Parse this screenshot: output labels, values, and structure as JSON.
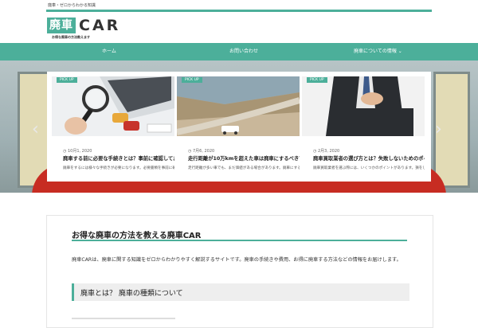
{
  "header": {
    "tagline": "廃車・ゼロからわかる知識",
    "logo_box": "廃車",
    "logo_car": "CAR",
    "logo_sub": "お得な廃車の方法教えます"
  },
  "nav": {
    "items": [
      {
        "label": "ホーム"
      },
      {
        "label": "お問い合わせ"
      },
      {
        "label": "廃車についての情報 ⌄"
      }
    ]
  },
  "slider": {
    "prev_icon": "‹",
    "next_icon": "›",
    "cards": [
      {
        "badge": "PICK UP",
        "date": "◷ 10月1, 2020",
        "title": "廃車する前に必要な手続きとは？事前に確認しておくべき書類",
        "desc": "廃車をするには様々な手続きが必要になります。必要書類を事前に確認し、スムーズに"
      },
      {
        "badge": "PICK UP",
        "date": "◷ 7月6, 2020",
        "title": "走行距離が10万kmを超えた車は廃車にするべき？その判断基準",
        "desc": "走行距離が多い車でも、まだ価値がある場合があります。廃車にするかどうかの判断"
      },
      {
        "badge": "PICK UP",
        "date": "◷ 2月3, 2020",
        "title": "廃車買取業者の選び方とは？失敗しないためのポイント",
        "desc": "廃車買取業者を選ぶ際には、いくつかのポイントがあります。損をしないために（続き） 続き"
      }
    ]
  },
  "intro": {
    "title": "お得な廃車の方法を教える廃車CAR",
    "text": "廃車CARは、廃車に関する知識をゼロからわかりやすく解説するサイトです。廃車の手続きや費用、お得に廃車する方法などの情報をお届けします。",
    "subheading": "廃車とは？ 廃車の種類について"
  }
}
